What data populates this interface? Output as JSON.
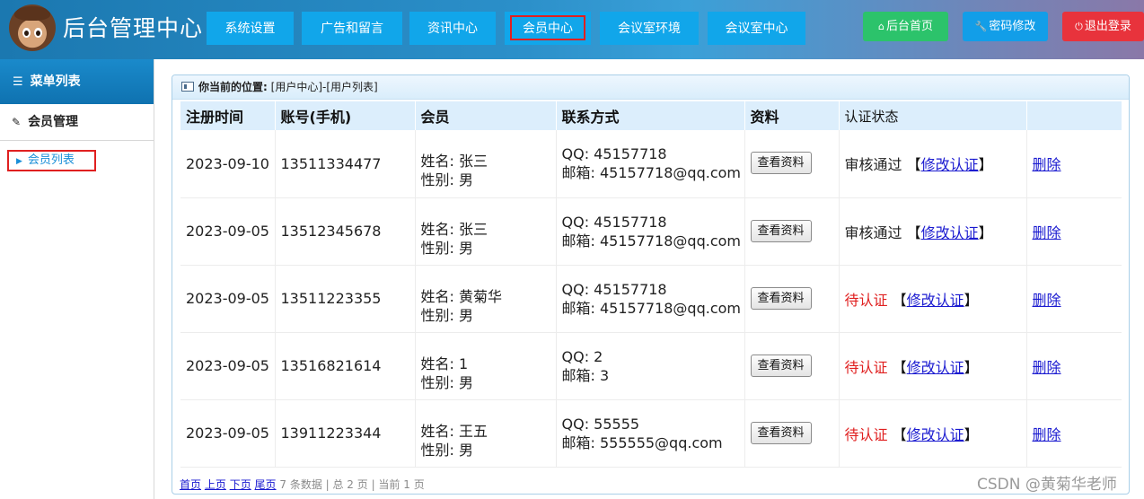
{
  "header": {
    "title": "后台管理中心",
    "nav": [
      {
        "label": "系统设置"
      },
      {
        "label": "广告和留言"
      },
      {
        "label": "资讯中心"
      },
      {
        "label": "会员中心",
        "active": true
      },
      {
        "label": "会议室环境"
      },
      {
        "label": "会议室中心"
      }
    ],
    "home_label": "后台首页",
    "password_label": "密码修改",
    "logout_label": "退出登录"
  },
  "sidebar": {
    "title": "菜单列表",
    "group_label": "会员管理",
    "item_label": "会员列表"
  },
  "breadcrumb": {
    "prefix": "你当前的位置:",
    "path": "[用户中心]-[用户列表]"
  },
  "table": {
    "columns": [
      "注册时间",
      "账号(手机)",
      "会员",
      "联系方式",
      "资料",
      "认证状态",
      ""
    ],
    "view_label": "查看资料",
    "modify_label": "修改认证",
    "delete_label": "删除",
    "rows": [
      {
        "date": "2023-09-10",
        "account": "13511334477",
        "name": "姓名: 张三",
        "gender": "性别: 男",
        "qq": "QQ: 45157718",
        "email": "邮箱: 45157718@qq.com",
        "status": "审核通过",
        "verified": true
      },
      {
        "date": "2023-09-05",
        "account": "13512345678",
        "name": "姓名: 张三",
        "gender": "性别: 男",
        "qq": "QQ: 45157718",
        "email": "邮箱: 45157718@qq.com",
        "status": "审核通过",
        "verified": true
      },
      {
        "date": "2023-09-05",
        "account": "13511223355",
        "name": "姓名: 黄菊华",
        "gender": "性别: 男",
        "qq": "QQ: 45157718",
        "email": "邮箱: 45157718@qq.com",
        "status": "待认证",
        "verified": false
      },
      {
        "date": "2023-09-05",
        "account": "13516821614",
        "name": "姓名: 1",
        "gender": "性别: 男",
        "qq": "QQ: 2",
        "email": "邮箱: 3",
        "status": "待认证",
        "verified": false
      },
      {
        "date": "2023-09-05",
        "account": "13911223344",
        "name": "姓名: 王五",
        "gender": "性别: 男",
        "qq": "QQ: 55555",
        "email": "邮箱: 555555@qq.com",
        "status": "待认证",
        "verified": false
      }
    ]
  },
  "pager": {
    "first": "首页",
    "prev": "上页",
    "next": "下页",
    "last": "尾页",
    "info": "7 条数据 | 总 2 页 | 当前 1 页"
  },
  "watermark": "CSDN @黄菊华老师",
  "colors": {
    "nav_button": "#11a6ea",
    "home_button": "#2cc36b",
    "password_button": "#129ee8",
    "logout_button": "#e8333c",
    "pending_status": "#e02020",
    "highlight_box": "#e02020"
  },
  "icons": {
    "home": "home-icon",
    "password": "wrench-icon",
    "logout": "power-icon",
    "menu": "list-icon",
    "group": "edit-icon",
    "item": "caret-right-icon",
    "crumb": "window-icon"
  }
}
